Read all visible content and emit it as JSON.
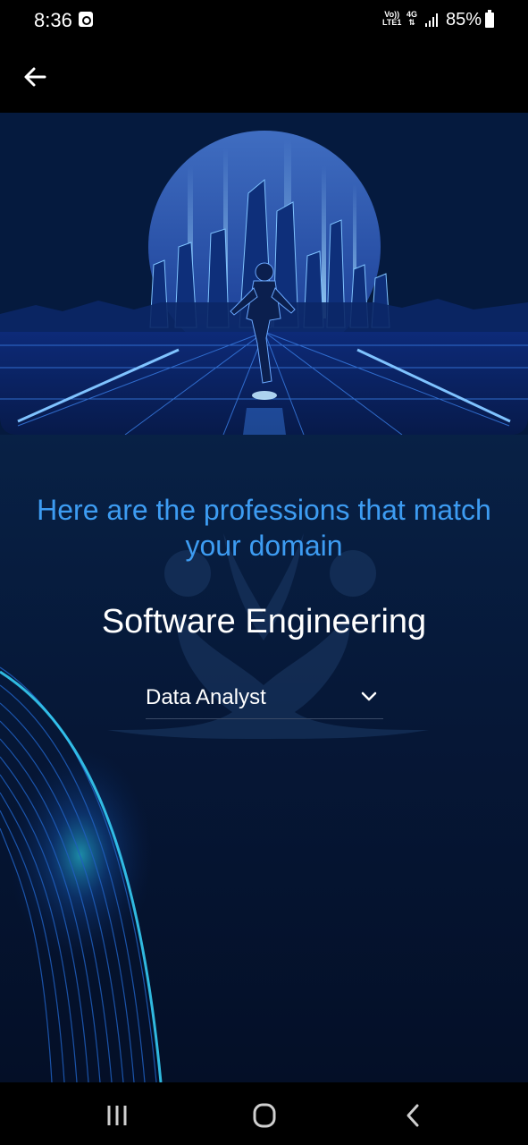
{
  "status_bar": {
    "time": "8:36",
    "volte_top": "Vo))",
    "volte_bottom": "LTE1",
    "net_top": "4G",
    "net_bottom": "⇅",
    "battery": "85%"
  },
  "screen": {
    "headline": "Here are the professions that match your domain",
    "domain": "Software Engineering",
    "profession_select": {
      "selected": "Data Analyst"
    }
  },
  "colors": {
    "accent": "#3d9cf2",
    "background_top": "#0a2a56",
    "background_bottom": "#040f27"
  },
  "icons": {
    "back": "arrow-left-icon",
    "dropdown": "chevron-down-icon",
    "nav_recents": "recents-icon",
    "nav_home": "home-icon",
    "nav_back": "nav-back-icon"
  }
}
